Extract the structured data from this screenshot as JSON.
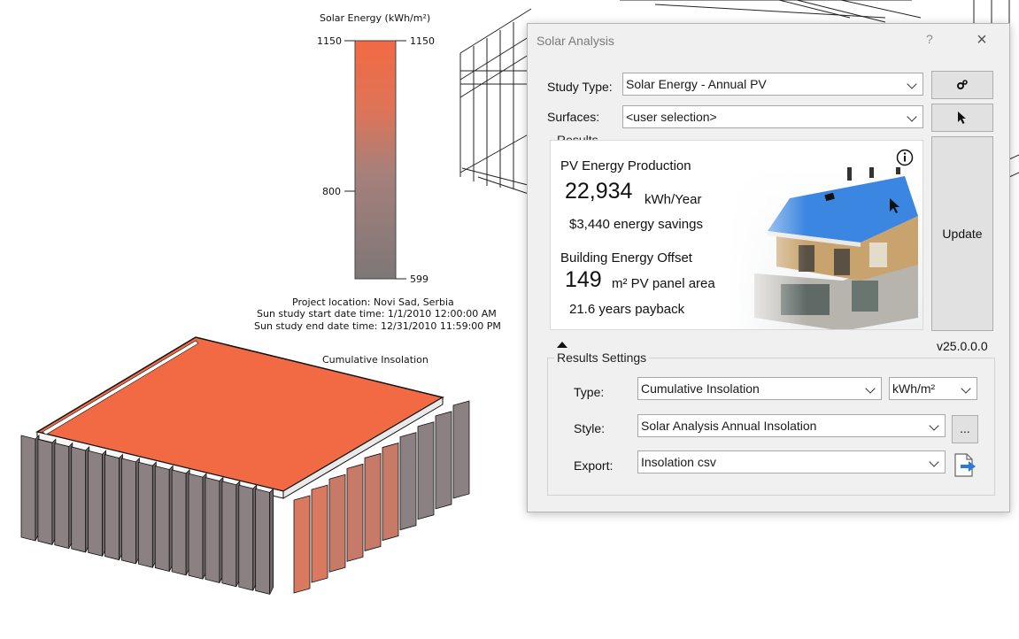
{
  "legend": {
    "title": "Solar Energy (kWh/m²)",
    "ticks_left": [
      "1150",
      "800"
    ],
    "ticks_right": [
      "1150",
      "599"
    ],
    "color_max": "#f26a43",
    "color_min": "#7d7778"
  },
  "study_info": {
    "location": "Project location: Novi Sad, Serbia",
    "start": "Sun study start date time: 1/1/2010 12:00:00 AM",
    "end": "Sun study end date time: 12/31/2010 11:59:00 PM",
    "view_label": "Cumulative Insolation"
  },
  "dialog": {
    "title": "Solar Analysis",
    "help": "?",
    "close": "×",
    "study_type_label": "Study Type:",
    "study_type_value": "Solar Energy - Annual PV",
    "settings_icon": "gear-icon",
    "surfaces_label": "Surfaces:",
    "surfaces_value": "<user selection>",
    "pick_icon": "cursor-arrow-icon",
    "results": {
      "group_title": "Results",
      "pv_heading": "PV Energy Production",
      "pv_value": "22,934",
      "pv_unit": "kWh/Year",
      "savings": "$3,440 energy savings",
      "offset_heading": "Building Energy Offset",
      "panel_value": "149",
      "panel_unit": "m² PV panel area",
      "payback": "21.6 years payback",
      "info_icon": "info-icon"
    },
    "update_label": "Update",
    "version": "v25.0.0.0",
    "settings": {
      "group_title": "Results Settings",
      "type_label": "Type:",
      "type_value": "Cumulative Insolation",
      "unit_value": "kWh/m²",
      "style_label": "Style:",
      "style_value": "Solar Analysis Annual Insolation",
      "style_more": "...",
      "export_label": "Export:",
      "export_value": "Insolation csv",
      "export_icon": "export-file-icon"
    },
    "collapse_icon": "triangle-up-icon"
  },
  "colors": {
    "roof": "#f26a43",
    "fin_gray": "#8b8182",
    "fin_orange": "#d97a60",
    "sky": "#3b86e0"
  }
}
